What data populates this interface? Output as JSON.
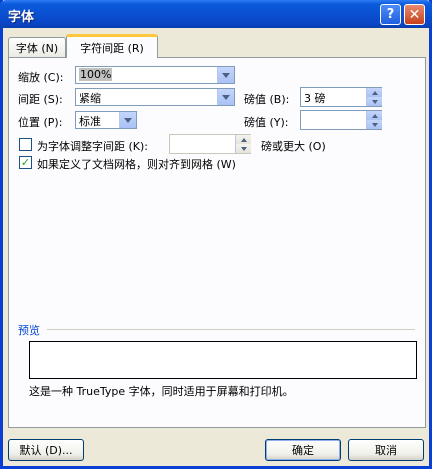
{
  "window": {
    "title": "字体",
    "help_glyph": "?",
    "close_glyph": "✕"
  },
  "tabs": [
    {
      "label": "字体 (N)",
      "selected": false
    },
    {
      "label": "字符间距 (R)",
      "selected": true
    }
  ],
  "scale": {
    "label": "缩放 (C):",
    "value": "100%"
  },
  "spacing": {
    "label": "间距 (S):",
    "value": "紧缩"
  },
  "spacing_pts": {
    "label": "磅值 (B):",
    "value": "3 磅"
  },
  "position": {
    "label": "位置 (P):",
    "value": "标准"
  },
  "position_pts": {
    "label": "磅值 (Y):",
    "value": ""
  },
  "kerning": {
    "label": "为字体调整字间距 (K):",
    "checked": false,
    "value": "",
    "suffix": "磅或更大 (O)"
  },
  "grid_snap": {
    "label": "如果定义了文档网格，则对齐到网格 (W)",
    "checked": true,
    "check_glyph": "✓"
  },
  "preview": {
    "title": "预览",
    "note": "这是一种 TrueType 字体，同时适用于屏幕和打印机。"
  },
  "buttons": {
    "default_label": "默认 (D)...",
    "ok_label": "确定",
    "cancel_label": "取消"
  },
  "colors": {
    "title_bar": "#0a4fd0",
    "dialog_bg": "#ece9d8",
    "tab_highlight": "#ffc83c",
    "section_title": "#0046d5"
  }
}
